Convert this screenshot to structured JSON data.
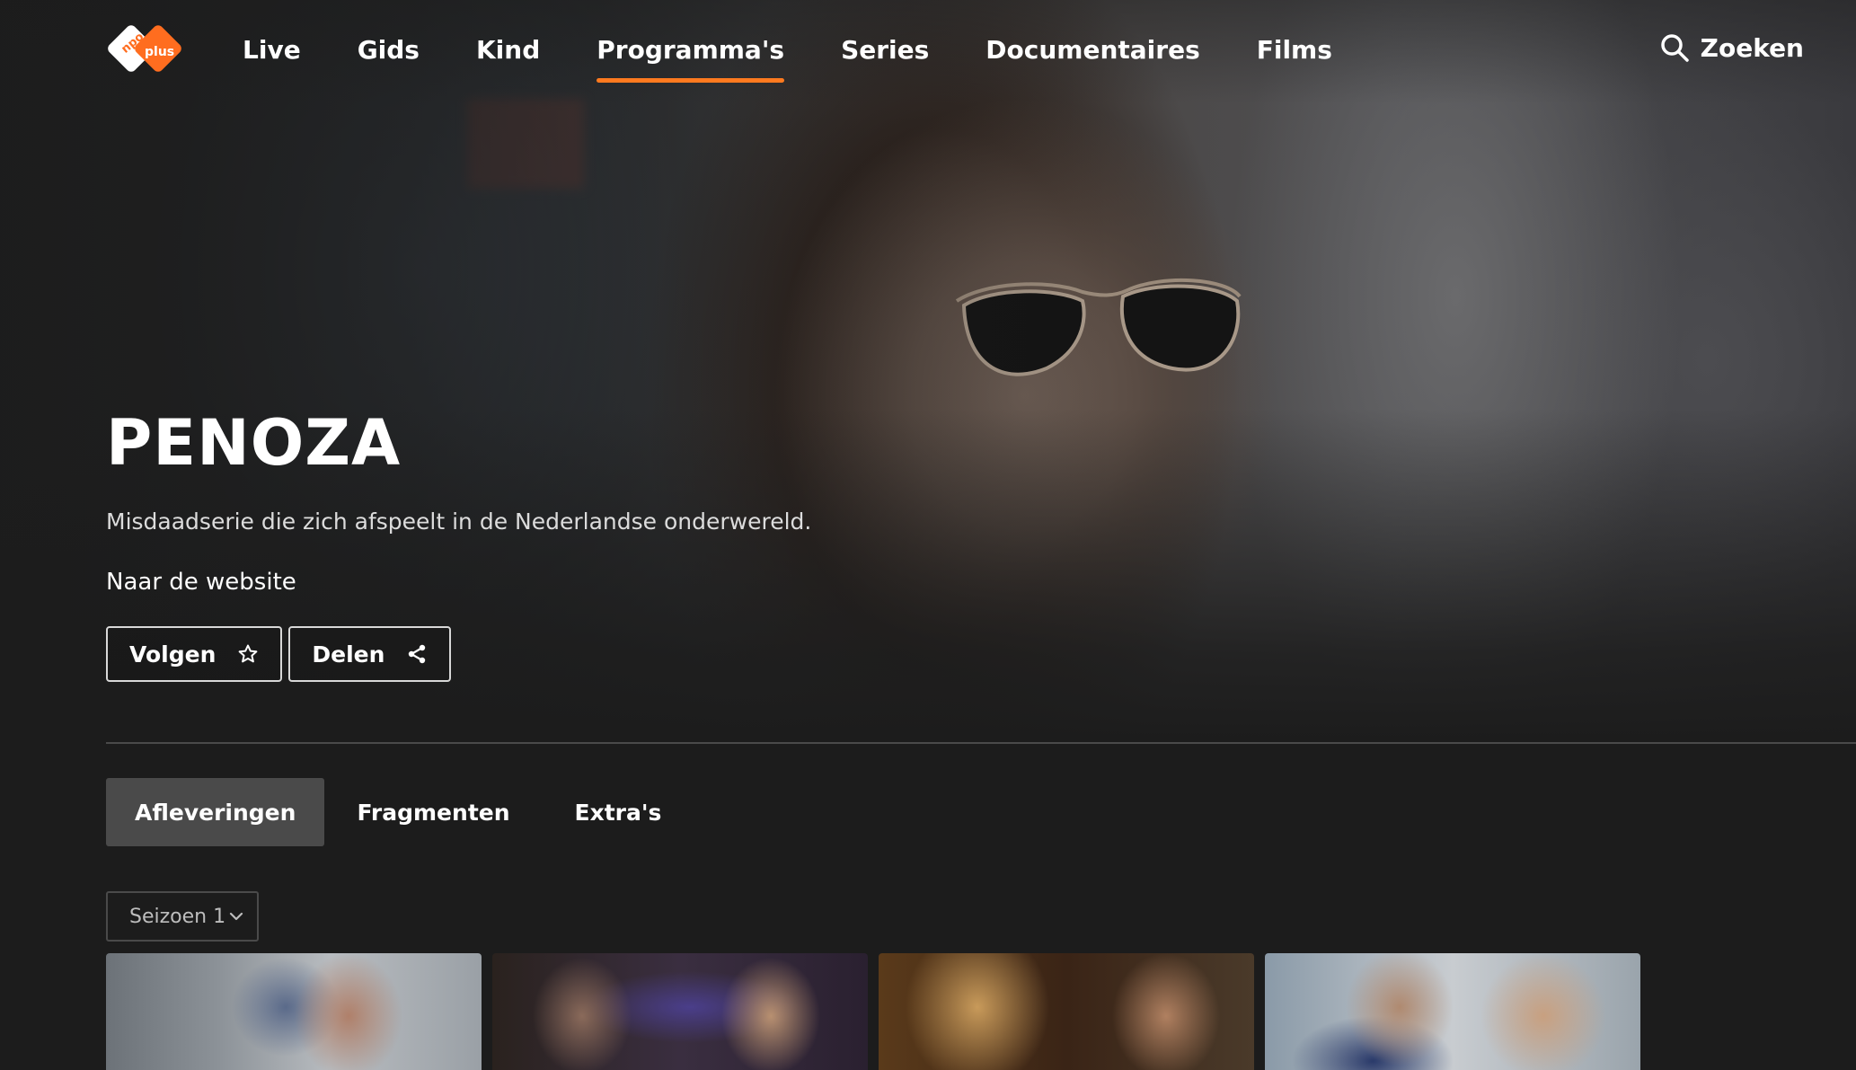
{
  "header": {
    "logo_text": "npo plus",
    "nav": [
      {
        "label": "Live",
        "active": false
      },
      {
        "label": "Gids",
        "active": false
      },
      {
        "label": "Kind",
        "active": false
      },
      {
        "label": "Programma's",
        "active": true
      },
      {
        "label": "Series",
        "active": false
      },
      {
        "label": "Documentaires",
        "active": false
      },
      {
        "label": "Films",
        "active": false
      }
    ],
    "search_label": "Zoeken",
    "search_icon": "search-icon"
  },
  "program": {
    "title": "PENOZA",
    "description": "Misdaadserie die zich afspeelt in de Nederlandse onderwereld.",
    "website_link": "Naar de website",
    "follow_label": "Volgen",
    "follow_icon": "star-outline-icon",
    "share_label": "Delen",
    "share_icon": "share-icon"
  },
  "tabs": [
    {
      "label": "Afleveringen",
      "active": true
    },
    {
      "label": "Fragmenten",
      "active": false
    },
    {
      "label": "Extra's",
      "active": false
    }
  ],
  "season_selector": {
    "selected": "Seizoen 1",
    "icon": "chevron-down-icon"
  },
  "colors": {
    "accent": "#ff7a1f",
    "background": "#1c1c1c",
    "tab_active_bg": "#4a4a4a"
  }
}
